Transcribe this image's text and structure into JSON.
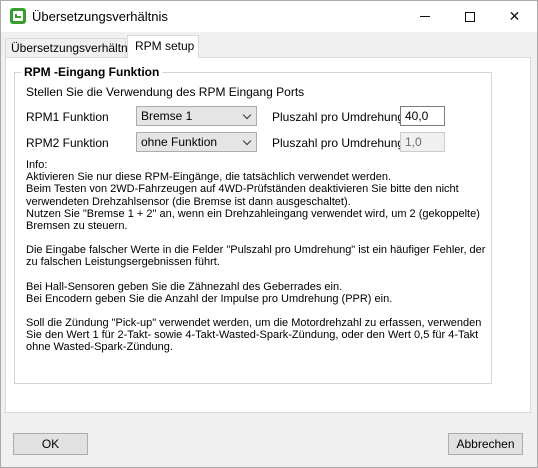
{
  "window": {
    "title": "Übersetzungsverhältnis",
    "minimize_glyph": "",
    "maximize_glyph": "",
    "close_glyph": "✕"
  },
  "tabs": [
    {
      "label": "Übersetzungsverhältnis",
      "active": false
    },
    {
      "label": "RPM setup",
      "active": true
    }
  ],
  "group": {
    "title": "RPM -Eingang Funktion",
    "description": "Stellen Sie die Verwendung des RPM Eingang Ports",
    "rows": [
      {
        "label": "RPM1 Funktion",
        "function": "Bremse 1",
        "pulse_label": "Pluszahl pro Umdrehung:",
        "pulse_value": "40,0",
        "enabled": true
      },
      {
        "label": "RPM2 Funktion",
        "function": "ohne Funktion",
        "pulse_label": "Pluszahl pro Umdrehung:",
        "pulse_value": "1,0",
        "enabled": false
      }
    ],
    "info_paragraphs": [
      "Info:\nAktivieren Sie nur diese RPM-Eingänge, die tatsächlich verwendet werden.\nBeim Testen von 2WD-Fahrzeugen auf 4WD-Prüfständen deaktivieren Sie bitte den nicht\nverwendeten Drehzahlsensor (die Bremse ist dann ausgeschaltet).\nNutzen Sie \"Bremse 1 + 2\" an, wenn ein Drehzahleingang verwendet wird, um 2 (gekoppelte)\nBremsen zu steuern.",
      "Die Eingabe falscher Werte in die Felder \"Pulszahl pro Umdrehung\" ist ein häufiger Fehler, der\nzu falschen Leistungsergebnissen führt.",
      "Bei Hall-Sensoren geben Sie die Zähnezahl des Geberrades ein.\nBei Encodern geben Sie die Anzahl der Impulse pro Umdrehung (PPR) ein.",
      "Soll die Zündung \"Pick-up\" verwendet werden, um die Motordrehzahl zu erfassen, verwenden\nSie den Wert 1 für 2-Takt- sowie 4-Takt-Wasted-Spark-Zündung, oder den Wert 0,5 für 4-Takt\nohne Wasted-Spark-Zündung."
    ]
  },
  "buttons": {
    "ok": "OK",
    "cancel": "Abbrechen"
  },
  "colors": {
    "icon_green": "#3a9e2f",
    "panel_bg": "#ffffff",
    "window_bg": "#f0f0f0"
  }
}
